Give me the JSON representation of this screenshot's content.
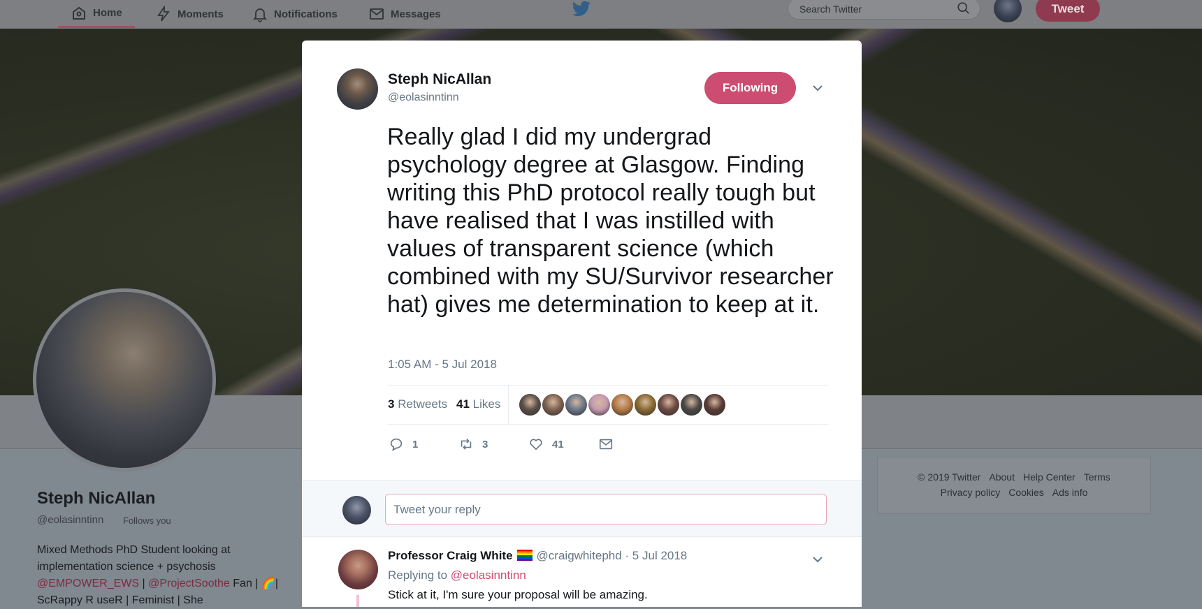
{
  "nav": {
    "home": "Home",
    "moments": "Moments",
    "notifications": "Notifications",
    "messages": "Messages",
    "search_placeholder": "Search Twitter",
    "tweet_button": "Tweet"
  },
  "profile": {
    "name": "Steph NicAllan",
    "handle": "@eolasinntinn",
    "follows_you": "Follows you",
    "bio_line1": "Mixed Methods PhD Student looking at",
    "bio_line2": "implementation science + psychosis",
    "bio_mention1": "@EMPOWER_EWS",
    "bio_sep1": " | ",
    "bio_mention2": "@ProjectSoothe",
    "bio_after": " Fan | 🌈|",
    "bio_line4": "ScRappy R useR | Feminist | She"
  },
  "footer": {
    "copyright": "© 2019 Twitter",
    "about": "About",
    "help": "Help Center",
    "terms": "Terms",
    "privacy": "Privacy policy",
    "cookies": "Cookies",
    "ads": "Ads info"
  },
  "tweet": {
    "author": "Steph NicAllan",
    "handle": "@eolasinntinn",
    "follow_label": "Following",
    "text": "Really glad I did my undergrad psychology degree at Glasgow. Finding writing this PhD protocol really tough but have realised that I was instilled with values of transparent science (which combined with my SU/Survivor researcher hat) gives me determination to keep at it.",
    "timestamp": "1:05 AM - 5 Jul 2018",
    "retweets_count": "3",
    "retweets_label": "Retweets",
    "likes_count": "41",
    "likes_label": "Likes",
    "reply_count": "1",
    "retweet_action_count": "3",
    "like_action_count": "41",
    "liker_colors": [
      "#5a4f48",
      "#7e6150",
      "#6d7888",
      "#c59ab0",
      "#b57a45",
      "#8a6a32",
      "#6e4a44",
      "#4b4846",
      "#5a3c36"
    ]
  },
  "reply_box": {
    "placeholder": "Tweet your reply"
  },
  "reply": {
    "author": "Professor Craig White",
    "handle_date": "@craigwhitephd · 5 Jul 2018",
    "replying_prefix": "Replying to ",
    "replying_to": "@eolasinntinn",
    "text": "Stick at it, I'm sure your proposal will be amazing."
  },
  "colors": {
    "accent": "#cd4d72",
    "modal_bg": "#ffffff",
    "overlay_tint": "#808890"
  }
}
